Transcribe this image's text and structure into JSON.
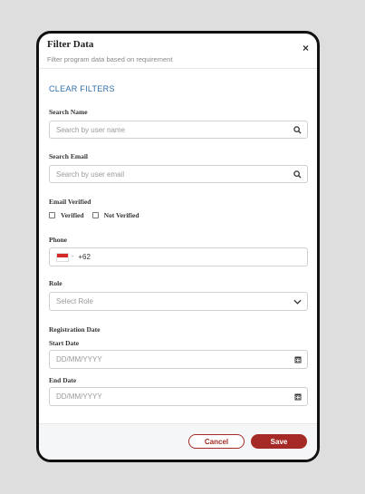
{
  "modal": {
    "title": "Filter Data",
    "subtitle": "Filter program data based on requirement",
    "close_icon": "×",
    "clear_filters": "CLEAR FILTERS"
  },
  "search_name": {
    "label": "Search Name",
    "placeholder": "Search by user name"
  },
  "search_email": {
    "label": "Search Email",
    "placeholder": "Search by user email"
  },
  "email_verified": {
    "label": "Email Verified",
    "options": [
      "Verified",
      "Not Verified"
    ]
  },
  "phone": {
    "label": "Phone",
    "code": "+62",
    "flag": "indonesia-flag-icon"
  },
  "role": {
    "label": "Role",
    "placeholder": "Select Role"
  },
  "registration_date": {
    "label": "Registration Date",
    "start_label": "Start Date",
    "end_label": "End Date",
    "placeholder": "DD/MM/YYYY"
  },
  "footer": {
    "cancel": "Cancel",
    "save": "Save"
  },
  "colors": {
    "accent": "#a52a25",
    "link": "#2f6fa8"
  }
}
